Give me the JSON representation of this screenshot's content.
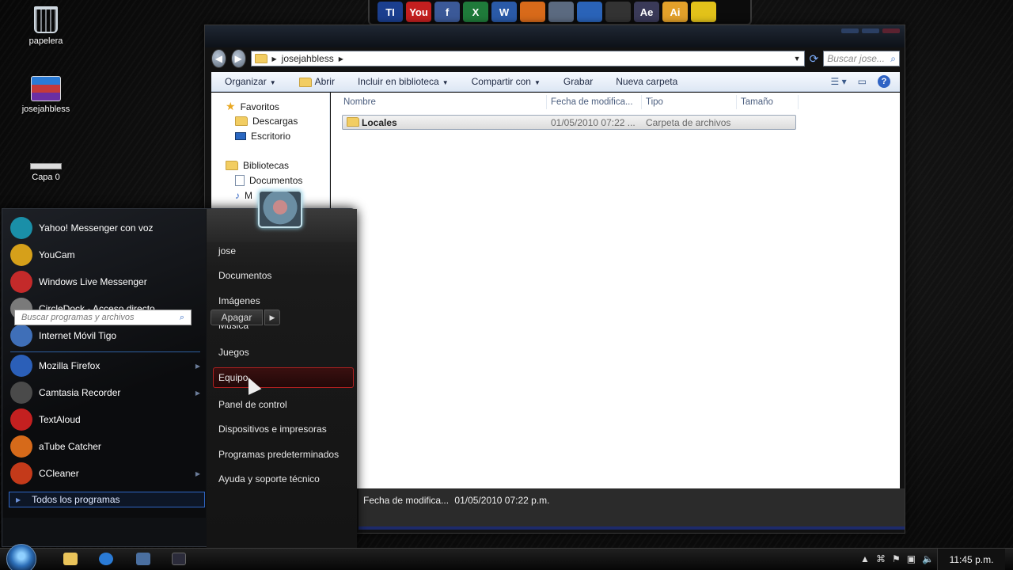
{
  "desktop": {
    "icons": [
      {
        "label": "papelera",
        "icon": "recycle-bin-icon"
      },
      {
        "label": "josejahbless",
        "icon": "winrar-icon"
      },
      {
        "label": "Capa 0",
        "icon": "layer-icon"
      }
    ]
  },
  "dock": {
    "items": [
      {
        "name": "taringa",
        "text": "TI",
        "color": "#1b3f8f"
      },
      {
        "name": "youtube",
        "text": "You",
        "color": "#c41f1f"
      },
      {
        "name": "facebook",
        "text": "f",
        "color": "#3b5998"
      },
      {
        "name": "excel",
        "text": "X",
        "color": "#1f7a3a"
      },
      {
        "name": "word",
        "text": "W",
        "color": "#2a5aa8"
      },
      {
        "name": "firefox",
        "text": "",
        "color": "#d86a1a"
      },
      {
        "name": "camtasia",
        "text": "",
        "color": "#5b6a80"
      },
      {
        "name": "msn",
        "text": "",
        "color": "#2a63b8"
      },
      {
        "name": "ubuntu",
        "text": "",
        "color": "#333333"
      },
      {
        "name": "after-effects",
        "text": "Ae",
        "color": "#3a3a58"
      },
      {
        "name": "illustrator",
        "text": "Ai",
        "color": "#e3a12a"
      },
      {
        "name": "beyond",
        "text": "",
        "color": "#e2c21a"
      }
    ]
  },
  "explorer": {
    "address": "josejahbless",
    "search_placeholder": "Buscar jose...",
    "toolbar": {
      "organize": "Organizar",
      "open": "Abrir",
      "include": "Incluir en biblioteca",
      "share": "Compartir con",
      "burn": "Grabar",
      "new_folder": "Nueva carpeta"
    },
    "nav": {
      "favorites": "Favoritos",
      "downloads": "Descargas",
      "desktop": "Escritorio",
      "libraries": "Bibliotecas",
      "documents": "Documentos",
      "music": "M"
    },
    "columns": {
      "name": "Nombre",
      "date": "Fecha de modifica...",
      "type": "Tipo",
      "size": "Tamaño"
    },
    "rows": [
      {
        "name": "Locales",
        "date": "01/05/2010 07:22 ...",
        "type": "Carpeta de archivos",
        "size": ""
      }
    ],
    "details": {
      "label": "Fecha de modifica...",
      "value": "01/05/2010 07:22 p.m."
    }
  },
  "start_menu": {
    "programs": [
      {
        "label": "Yahoo! Messenger con voz",
        "color": "#1a8fa8",
        "icon": "yahoo-messenger-icon",
        "arrow": ""
      },
      {
        "label": "YouCam",
        "color": "#d6a01a",
        "icon": "youcam-icon",
        "arrow": ""
      },
      {
        "label": "Windows Live Messenger",
        "color": "#c42a2a",
        "icon": "live-messenger-icon",
        "arrow": ""
      },
      {
        "label": "CircleDock - Acceso directo",
        "color": "#7a7a7a",
        "icon": "circledock-icon",
        "arrow": ""
      },
      {
        "label": "Internet Móvil Tigo",
        "color": "#3f6fb8",
        "icon": "tigo-icon",
        "arrow": ""
      },
      {
        "label": "Mozilla Firefox",
        "color": "#2b5fb8",
        "icon": "firefox-icon",
        "arrow": "▶"
      },
      {
        "label": "Camtasia Recorder",
        "color": "#4a4a4a",
        "icon": "camtasia-icon",
        "arrow": "▶"
      },
      {
        "label": "TextAloud",
        "color": "#c42020",
        "icon": "textaloud-icon",
        "arrow": ""
      },
      {
        "label": "aTube Catcher",
        "color": "#d66a1a",
        "icon": "atube-icon",
        "arrow": ""
      },
      {
        "label": "CCleaner",
        "color": "#c43a1a",
        "icon": "ccleaner-icon",
        "arrow": "▶"
      }
    ],
    "all_programs": "Todos los programas",
    "search_placeholder": "Buscar programas y archivos",
    "right": [
      "jose",
      "Documentos",
      "Imágenes",
      "Música",
      "Juegos",
      "Equipo",
      "Panel de control",
      "Dispositivos e impresoras",
      "Programas predeterminados",
      "Ayuda y soporte técnico"
    ],
    "shutdown": "Apagar"
  },
  "taskbar": {
    "clock": "11:45 p.m."
  }
}
